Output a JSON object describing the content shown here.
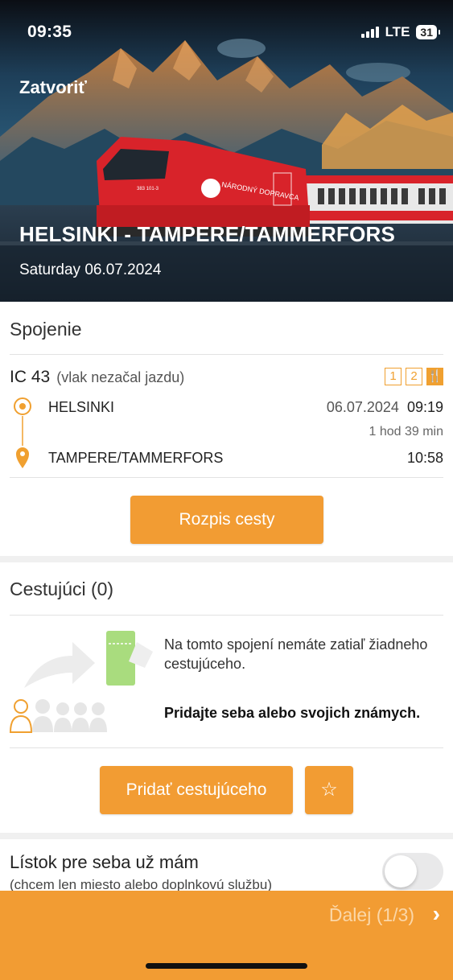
{
  "status_bar": {
    "time": "09:35",
    "network": "LTE",
    "battery": "31"
  },
  "header": {
    "close_label": "Zatvoriť",
    "route": "HELSINKI - TAMPERE/TAMMERFORS",
    "date": "Saturday 06.07.2024",
    "locomotive_text": "NÁRODNÝ DOPRAVCA",
    "locomotive_number": "383 101-3"
  },
  "connection": {
    "section_title": "Spojenie",
    "train": "IC 43",
    "train_status": "(vlak nezačal jazdu)",
    "badges": [
      "1",
      "2",
      "🍴"
    ],
    "from": {
      "name": "HELSINKI",
      "date": "06.07.2024",
      "time": "09:19"
    },
    "duration": "1 hod 39 min",
    "to": {
      "name": "TAMPERE/TAMMERFORS",
      "time": "10:58"
    },
    "itinerary_button": "Rozpis cesty"
  },
  "passengers": {
    "section_title": "Cestujúci (0)",
    "empty_message": "Na tomto spojení nemáte zatiaľ žiadneho cestujúceho.",
    "hint": "Pridajte seba alebo svojich známych.",
    "add_button": "Pridať cestujúceho",
    "favorite_icon": "star-icon"
  },
  "own_ticket": {
    "label": "Lístok pre seba už mám",
    "sublabel": "(chcem len miesto alebo doplnkovú službu)",
    "toggle_on": false
  },
  "footer": {
    "next_label": "Ďalej (1/3)",
    "arrow_icon": "chevron-right-icon"
  },
  "colors": {
    "accent": "#f29c33",
    "train_red": "#d8232a",
    "sky": "#1e4a66"
  }
}
